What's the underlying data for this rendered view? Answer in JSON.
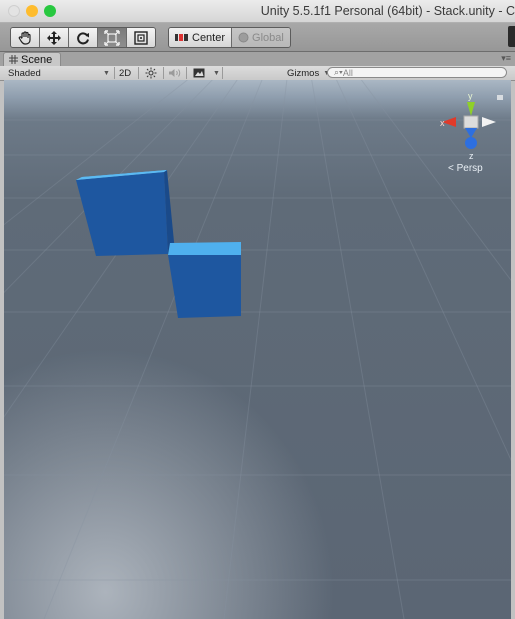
{
  "window": {
    "title": "Unity 5.5.1f1 Personal (64bit) - Stack.unity - C"
  },
  "toolbar": {
    "tools": [
      "hand-tool-icon",
      "move-tool-icon",
      "rotate-tool-icon",
      "scale-tool-icon",
      "rect-tool-icon"
    ],
    "pivot_label": "Center",
    "space_label": "Global"
  },
  "scene_tab": {
    "label": "Scene"
  },
  "scene_bar": {
    "shading_mode": "Shaded",
    "two_d_label": "2D",
    "gizmos_label": "Gizmos",
    "search_placeholder": "All"
  },
  "gizmo": {
    "y_label": "y",
    "x_label": "x",
    "z_label": "z",
    "projection_label": "Persp"
  },
  "colors": {
    "cube_top": "#4fb0ee",
    "cube_face": "#1e57a0",
    "cube_side": "#1a4a8a",
    "axis_x": "#e03a2a",
    "axis_y": "#8fd028",
    "axis_z": "#2d6fe0"
  }
}
